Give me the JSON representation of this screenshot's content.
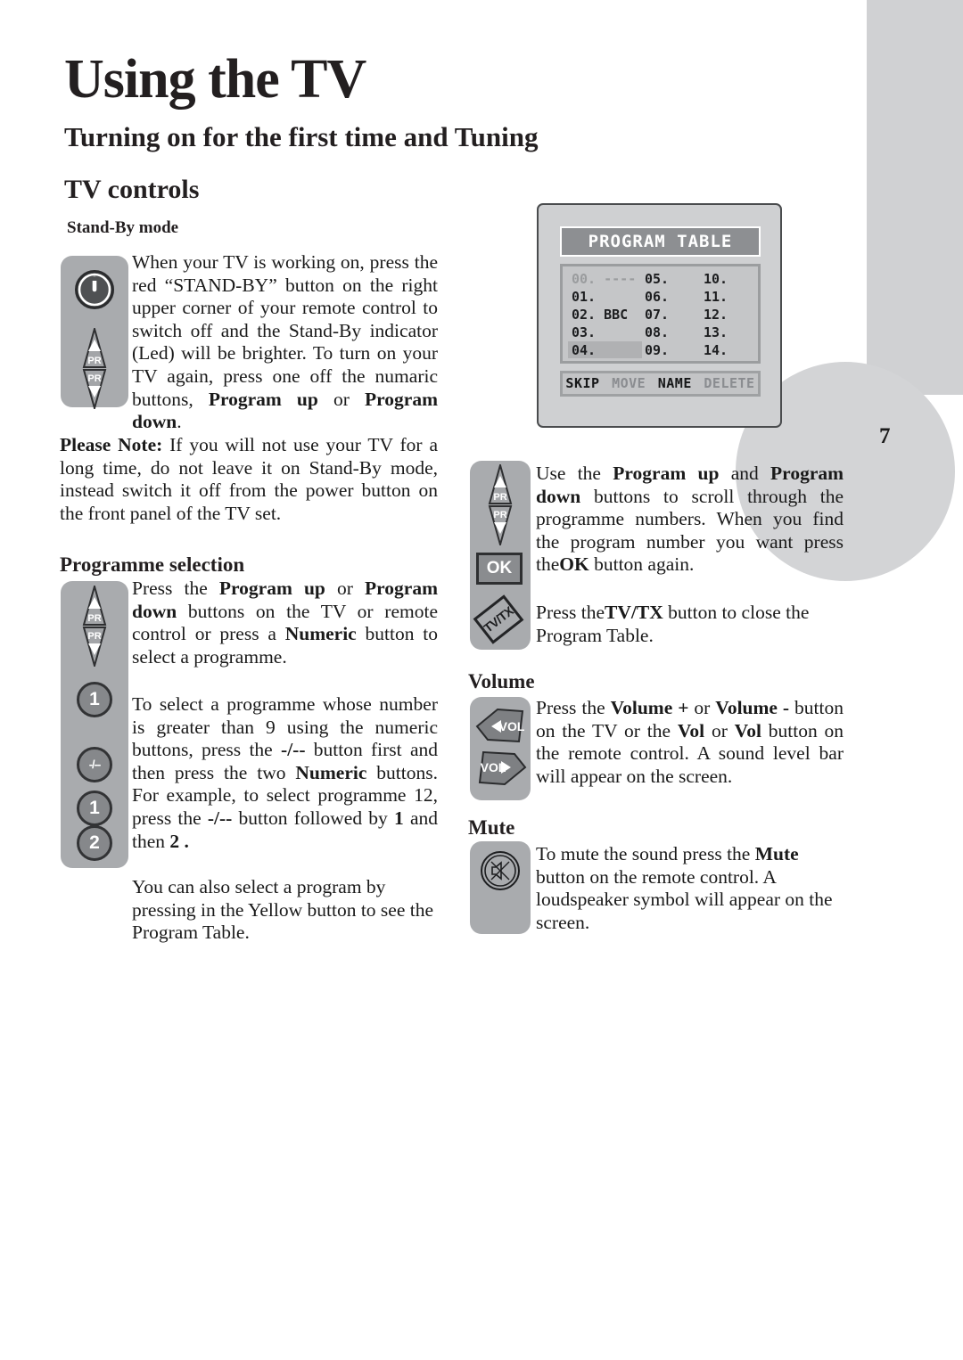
{
  "page": {
    "title": "Using the TV",
    "subtitle": "Turning on for the first time and Tuning",
    "section": "TV controls",
    "page_number": "7"
  },
  "standby": {
    "heading": "Stand-By mode",
    "body_html": "When your TV is working on, press the red “STAND-BY” button on the right upper corner  of your remote control to switch off and the Stand-By indicator (Led) will be brighter. To turn on your TV again, press one off the numaric buttons, <b>Program up</b> or <b>Program down</b>.",
    "note_html": "<b>Please Note:</b>  If you will not use your TV for a long time, do not leave it on Stand-By mode, instead switch it off from the power button on the front panel of the TV set.",
    "keys": {
      "power_label": "power-standby",
      "pr_up_label": "PR",
      "pr_down_label": "PR"
    }
  },
  "programme_selection": {
    "heading": "Programme selection",
    "p1_html": "Press the <b>Program up</b> or <b>Program down</b>  buttons on the TV or remote control or press a <b>Numeric</b> button to select a programme.",
    "p2_html": "To select a programme whose number is greater than 9 using the numeric buttons, press the <b>-/--</b> button first and then press the two <b>Numeric</b>  buttons.  For example, to select programme 12, press the <b>-/--</b> button followed by <b>1</b> and then <b>2 .</b>",
    "p3_html": "You can also select a program by pressing in the Yellow button to see the  Program Table.",
    "keys": {
      "pr_label": "PR",
      "num_1": "1",
      "dash": "-/--",
      "num_1b": "1",
      "num_2": "2"
    }
  },
  "program_table_screen": {
    "title": "PROGRAM TABLE",
    "rows": [
      {
        "c1": "00. ----",
        "c2": "05.",
        "c3": "10.",
        "dim": true,
        "highlight": false
      },
      {
        "c1": "01.",
        "c2": "06.",
        "c3": "11.",
        "dim": false,
        "highlight": false
      },
      {
        "c1": "02. BBC",
        "c2": "07.",
        "c3": "12.",
        "dim": false,
        "highlight": false
      },
      {
        "c1": "03.",
        "c2": "08.",
        "c3": "13.",
        "dim": false,
        "highlight": false
      },
      {
        "c1": "04.",
        "c2": "09.",
        "c3": "14.",
        "dim": false,
        "highlight": true
      }
    ],
    "menu": [
      {
        "label": "SKIP",
        "style": "dark"
      },
      {
        "label": "MOVE",
        "style": "light"
      },
      {
        "label": "NAME",
        "style": "dark"
      },
      {
        "label": "DELETE",
        "style": "light"
      }
    ]
  },
  "table_nav": {
    "p1_html": "Use the <b>Program up</b>  and <b>Program down</b>  buttons to scroll through the programme numbers.  When you find the program number you want press the<b>OK</b> button again.",
    "p2_html": "Press the<b>TV/TX</b>  button to close the Program Table.",
    "keys": {
      "pr_label": "PR",
      "ok": "OK",
      "tvtx": "TV/TX"
    }
  },
  "volume": {
    "heading": "Volume",
    "body_html": "Press the <b>Volume +</b>  or <b>Volume -</b> button on the TV or the <b>Vol</b>    or <b>Vol</b>     button on the remote control. A sound level bar will appear on the screen.",
    "keys": {
      "vol_down": "VOL",
      "vol_up": "VOL"
    }
  },
  "mute": {
    "heading": "Mute",
    "body_html": "To mute the sound press the <b>Mute</b> button on the remote control.  A loudspeaker symbol will appear on the screen.",
    "keys": {
      "mute": "mute"
    }
  },
  "colors": {
    "pad_gray": "#a9abae",
    "deco_gray": "#d0d1d3",
    "screen_gray": "#cfd0d2",
    "text": "#1a1a1a"
  }
}
